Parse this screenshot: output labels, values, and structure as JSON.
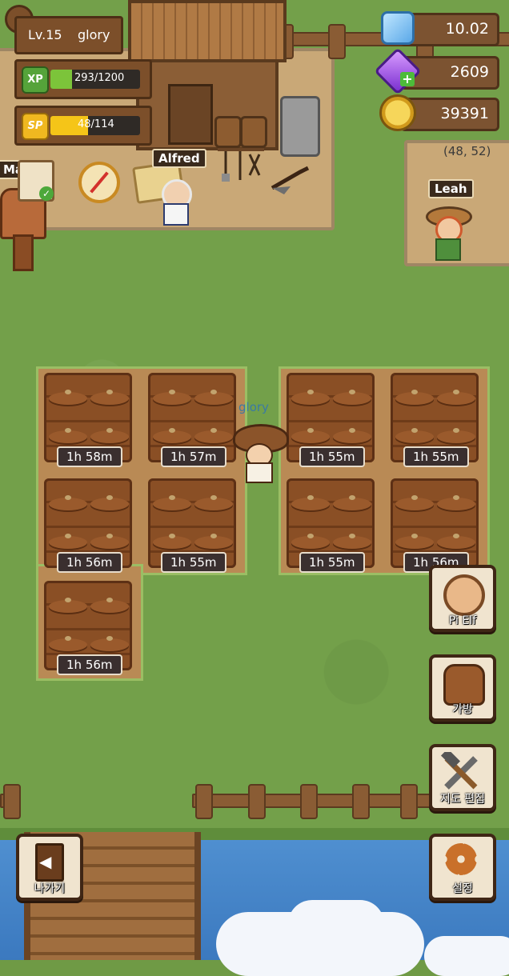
{
  "player": {
    "level": "Lv.15",
    "name": "glory"
  },
  "xp": {
    "label": "XP",
    "value": "293/1200",
    "fraction": 0.244
  },
  "sp": {
    "label": "SP",
    "value": "48/114",
    "fraction": 0.42
  },
  "resources": {
    "crystal": "10.02",
    "gem": "2609",
    "coin": "39391"
  },
  "coords": "(48, 52)",
  "npcs": {
    "alfred": "Alfred",
    "leah": "Leah",
    "mailbox": "Mailb"
  },
  "player_tag": "glory",
  "plots_left": [
    "1h 58m",
    "1h 57m",
    "1h 56m",
    "1h 55m",
    "1h 56m"
  ],
  "plots_right": [
    "1h 55m",
    "1h 55m",
    "1h 55m",
    "1h 56m"
  ],
  "side_buttons": {
    "npc": "Pi Elf",
    "bag": "가방",
    "map_edit": "지도 편집",
    "settings": "설정",
    "exit": "나가기"
  },
  "colors": {
    "xp": "#7cc43a",
    "sp": "#f5c518"
  }
}
